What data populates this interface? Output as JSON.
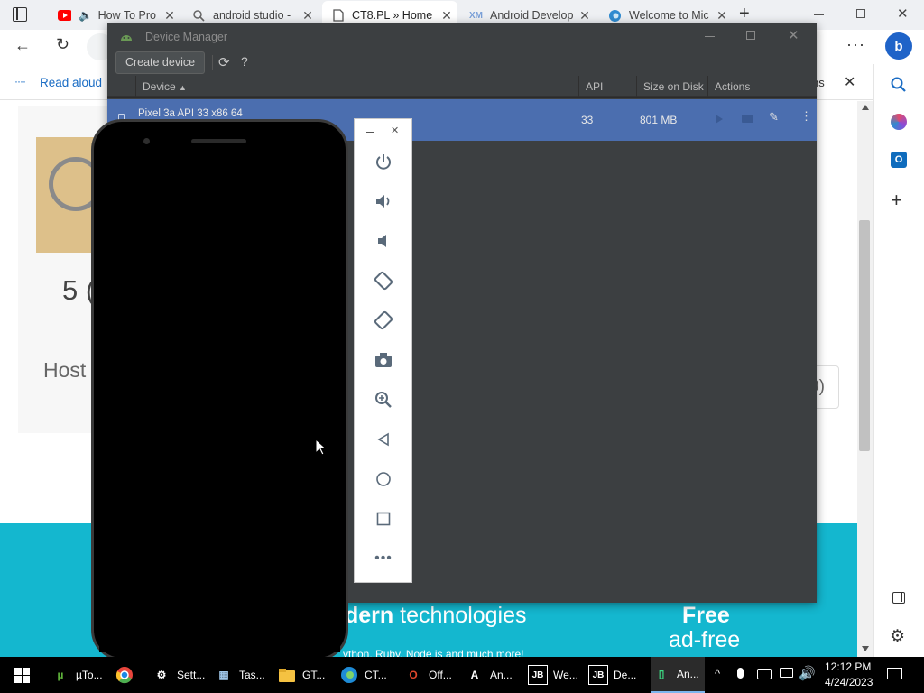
{
  "browser": {
    "tabs": [
      {
        "title": "How To Pro"
      },
      {
        "title": "android studio -"
      },
      {
        "title": "CT8.PL » Home"
      },
      {
        "title": "Android Develop"
      },
      {
        "title": "Welcome to Mic"
      }
    ],
    "favorites_bar": {
      "read_aloud": "Read aloud",
      "overflow_text": "ns"
    }
  },
  "page": {
    "stat_number": "5 (",
    "host_text": "Host",
    "partial_button": "0)",
    "banner": {
      "tech_bold": "dern",
      "tech_rest": " technologies",
      "subline": "ython, Ruby, Node is and much more!",
      "free": "Free",
      "adfree": "ad-free"
    }
  },
  "device_manager": {
    "title": "Device Manager",
    "create_button": "Create device",
    "help": "?",
    "columns": {
      "device": "Device",
      "api": "API",
      "size": "Size on Disk",
      "actions": "Actions"
    },
    "devices": [
      {
        "name": "Pixel 3a API 33 x86 64",
        "api": "33",
        "size": "801 MB"
      }
    ]
  },
  "taskbar": {
    "apps": [
      {
        "label": "µTo...",
        "icon": "utorrent-icon",
        "color": "#5fb33b"
      },
      {
        "label": "",
        "icon": "chrome-icon",
        "color": "#e8453c"
      },
      {
        "label": "Sett...",
        "icon": "settings-icon",
        "color": "#ffffff"
      },
      {
        "label": "Tas...",
        "icon": "task-manager-icon",
        "color": "#9fc6e8"
      },
      {
        "label": "GT...",
        "icon": "folder-icon",
        "color": "#f5c242"
      },
      {
        "label": "CT...",
        "icon": "edge-icon",
        "color": "#1e8bd6"
      },
      {
        "label": "Off...",
        "icon": "office-icon",
        "color": "#e0472b"
      },
      {
        "label": "An...",
        "icon": "android-studio-icon",
        "color": "#ffffff"
      },
      {
        "label": "We...",
        "icon": "jetbrains-icon",
        "color": "#ffffff"
      },
      {
        "label": "De...",
        "icon": "jetbrains-icon",
        "color": "#ffffff"
      },
      {
        "label": "An...",
        "icon": "android-emulator-icon",
        "color": "#3ddc84"
      }
    ],
    "time": "12:12 PM",
    "date": "4/24/2023"
  }
}
